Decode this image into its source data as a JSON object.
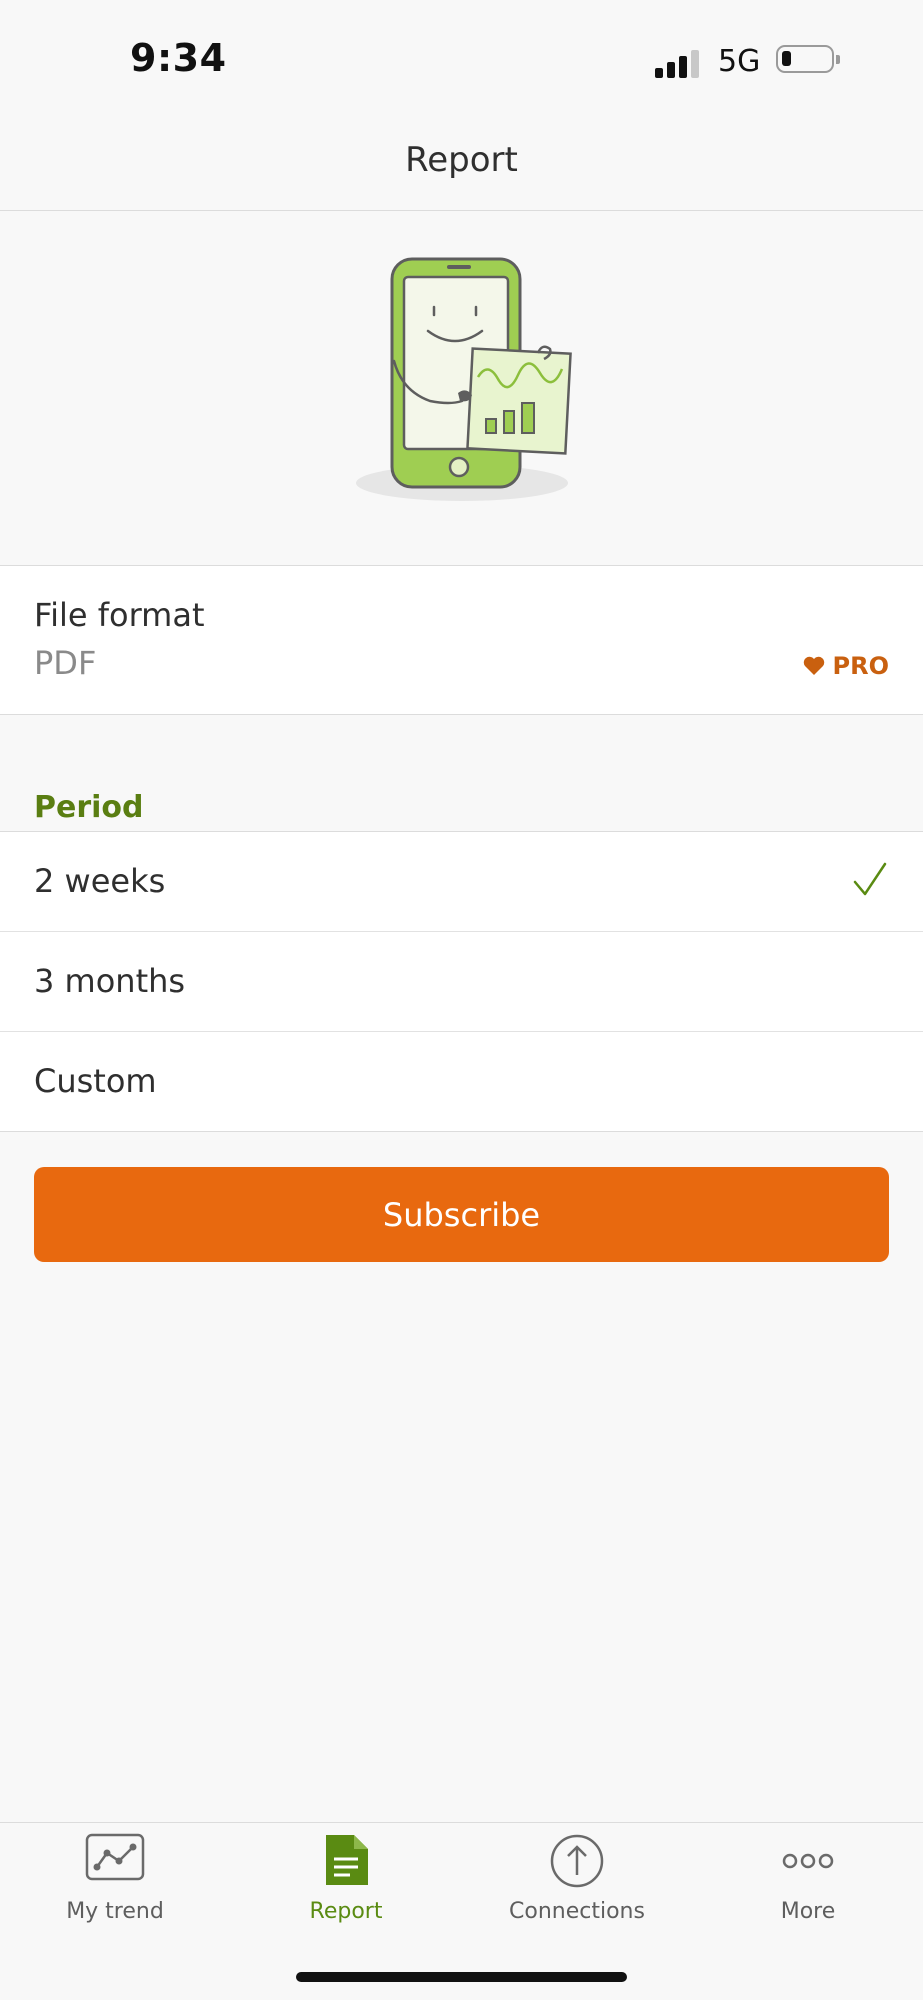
{
  "status_bar": {
    "time": "9:34",
    "network": "5G"
  },
  "header": {
    "title": "Report"
  },
  "file_format": {
    "label": "File format",
    "value": "PDF",
    "badge": "PRO"
  },
  "period": {
    "heading": "Period",
    "options": [
      {
        "label": "2 weeks",
        "selected": true
      },
      {
        "label": "3 months",
        "selected": false
      },
      {
        "label": "Custom",
        "selected": false
      }
    ]
  },
  "subscribe": {
    "label": "Subscribe"
  },
  "tab_bar": {
    "tabs": [
      {
        "label": "My trend",
        "icon": "trend-icon",
        "active": false
      },
      {
        "label": "Report",
        "icon": "document-icon",
        "active": true
      },
      {
        "label": "Connections",
        "icon": "upload-icon",
        "active": false
      },
      {
        "label": "More",
        "icon": "more-dots-icon",
        "active": false
      }
    ]
  },
  "colors": {
    "accent_green": "#5a7e12",
    "accent_orange": "#e8690f",
    "pro_brown": "#c9600f",
    "background": "#f8f8f8"
  }
}
